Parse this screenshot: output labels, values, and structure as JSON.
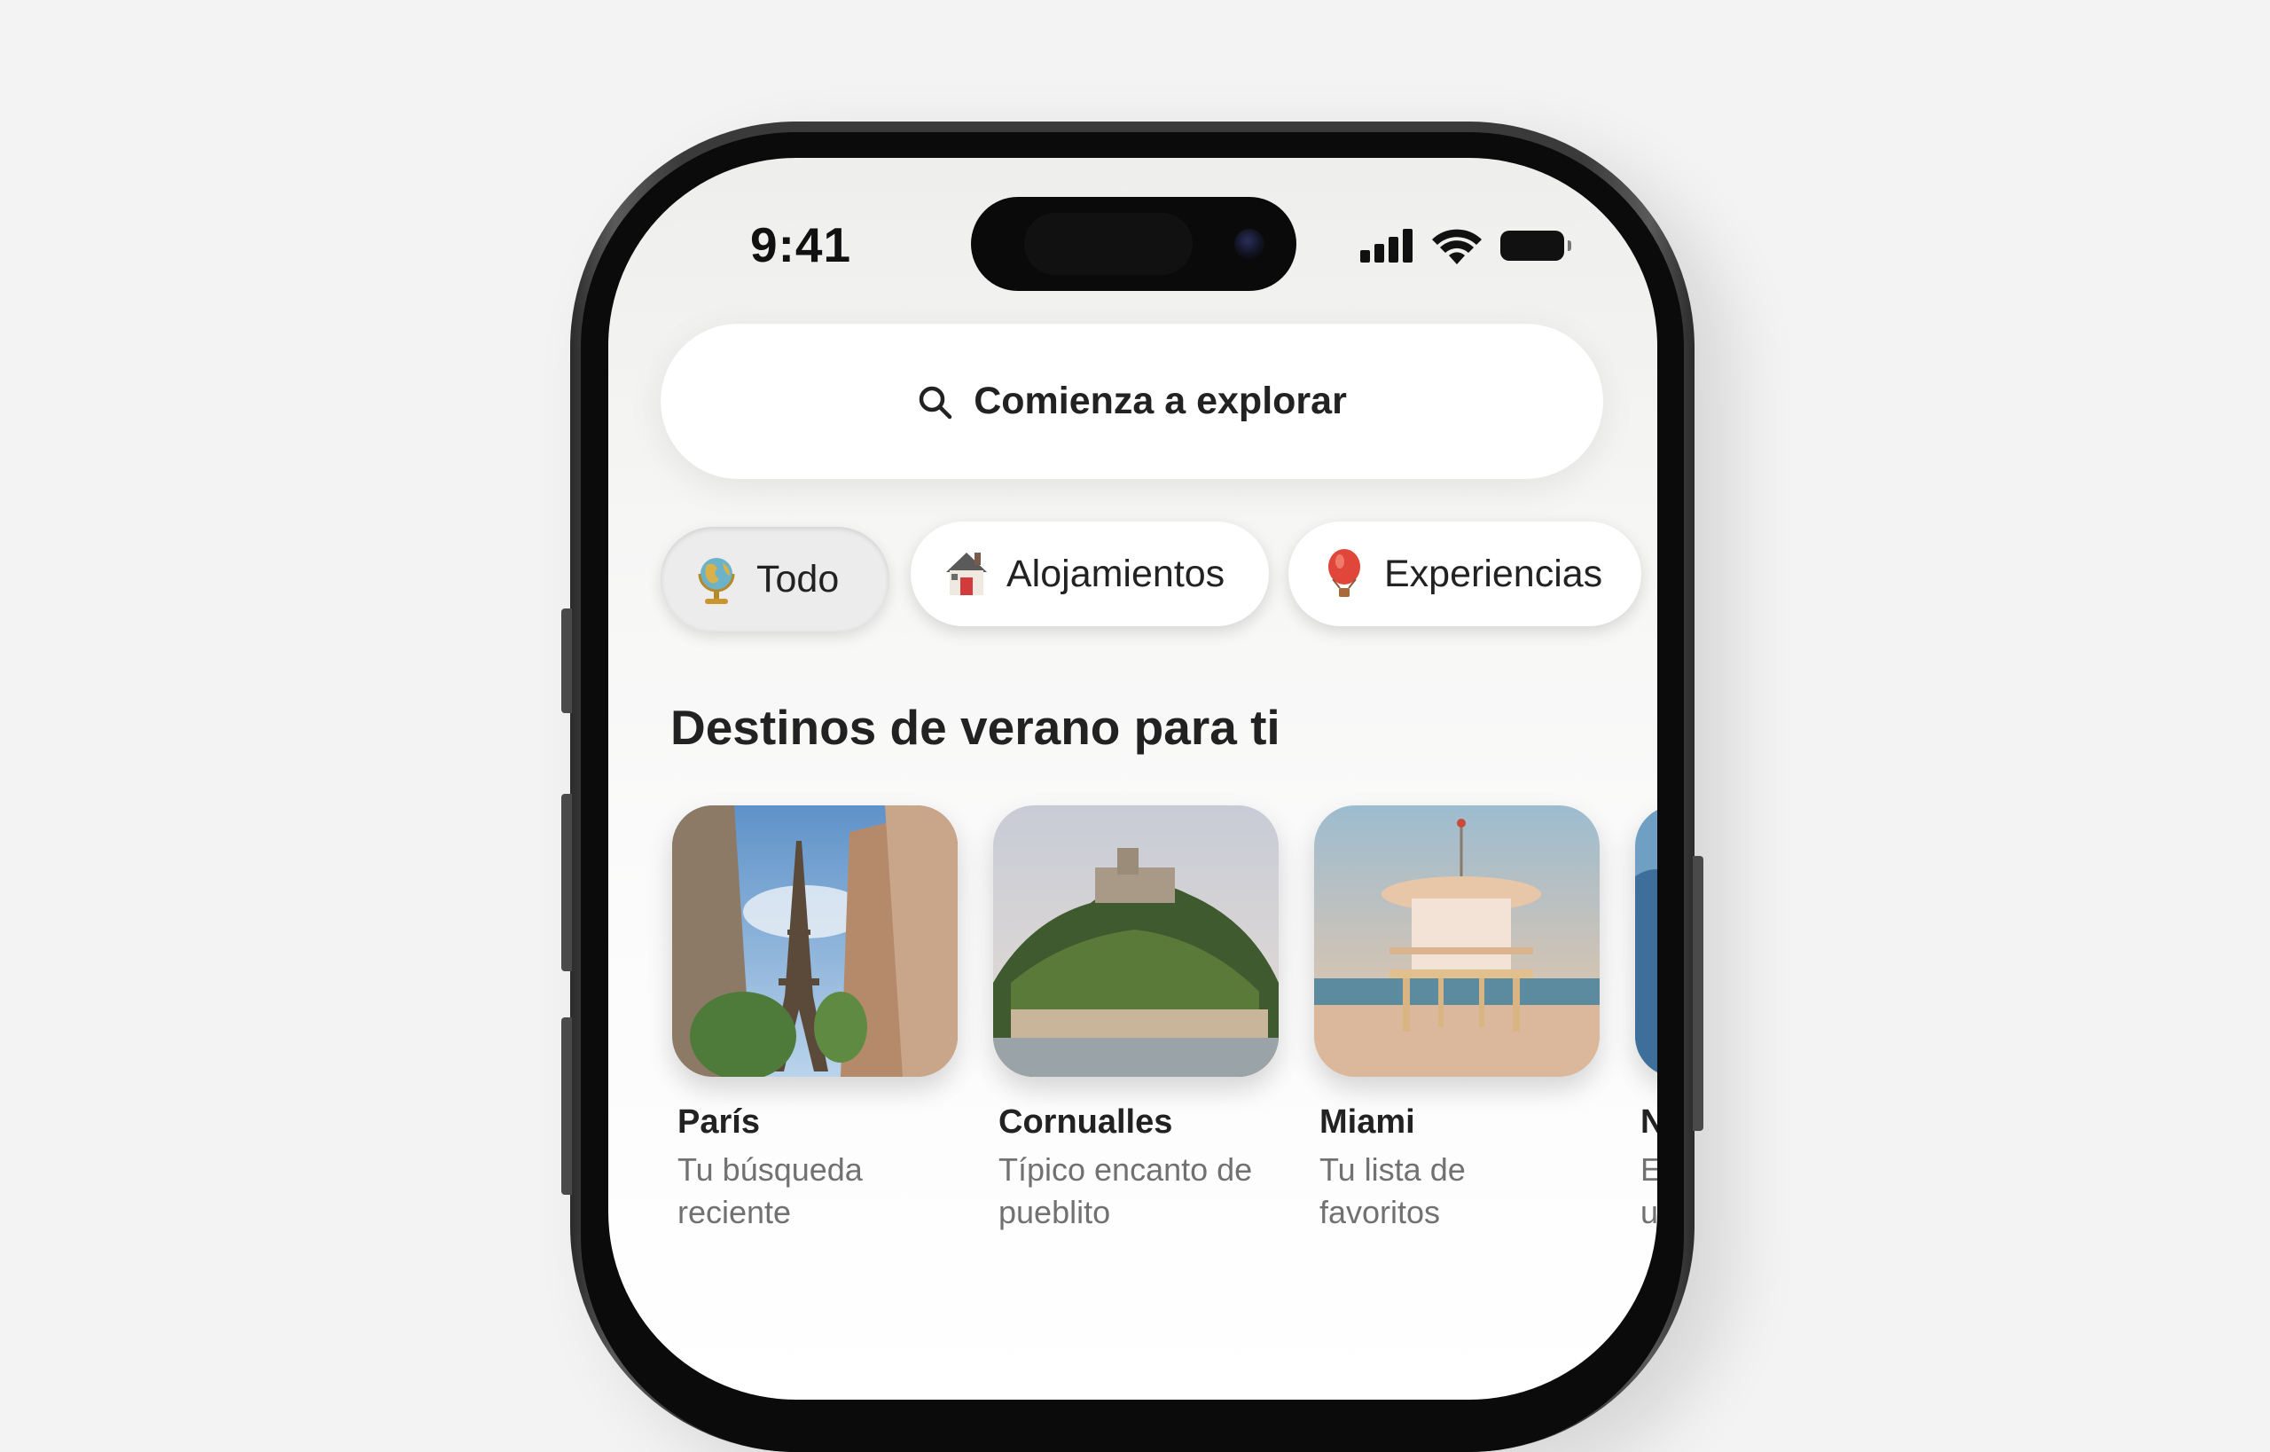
{
  "status_bar": {
    "time": "9:41"
  },
  "search": {
    "placeholder": "Comienza a explorar"
  },
  "categories": [
    {
      "label": "Todo",
      "icon": "globe-icon",
      "selected": true
    },
    {
      "label": "Alojamientos",
      "icon": "house-icon",
      "selected": false
    },
    {
      "label": "Experiencias",
      "icon": "hot-air-balloon-icon",
      "selected": false
    }
  ],
  "section": {
    "title": "Destinos de verano para ti"
  },
  "destinations": [
    {
      "title": "París",
      "subtitle": "Tu búsqueda reciente"
    },
    {
      "title": "Cornualles",
      "subtitle": "Típico encanto de pueblito"
    },
    {
      "title": "Miami",
      "subtitle": "Tu lista de favoritos"
    },
    {
      "title": "N",
      "subtitle": "E u"
    }
  ]
}
